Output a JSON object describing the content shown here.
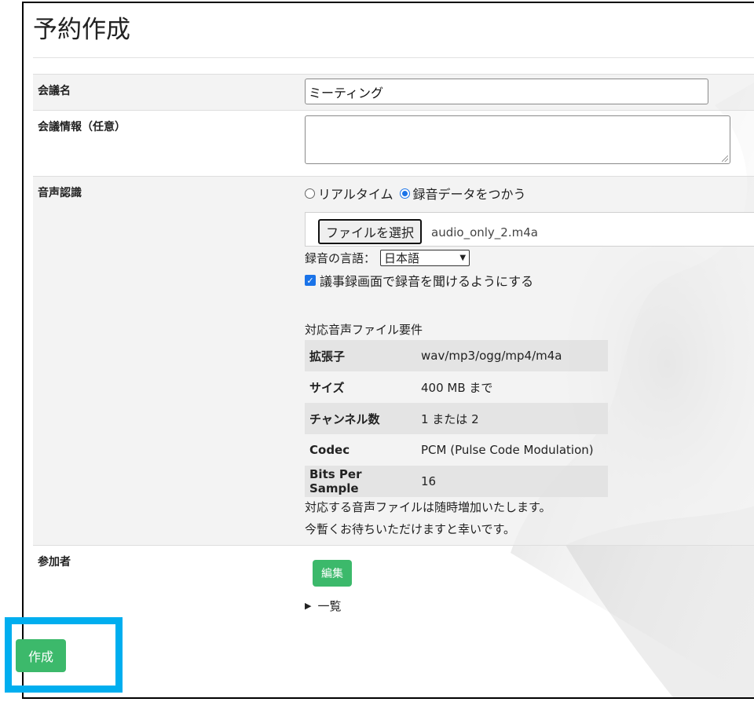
{
  "page": {
    "title": "予約作成"
  },
  "meeting_name": {
    "label": "会議名",
    "value": "ミーティング"
  },
  "meeting_info": {
    "label": "会議情報（任意）",
    "value": ""
  },
  "speech": {
    "label": "音声認識",
    "options": [
      "リアルタイム",
      "録音データをつかう"
    ],
    "selected": "録音データをつかう",
    "file_button": "ファイルを選択",
    "file_name": "audio_only_2.m4a",
    "language_label": "録音の言語：",
    "language_value": "日本語",
    "playback_checkbox": "議事録画面で録音を聞けるようにする",
    "playback_checked": true,
    "requirements_title": "対応音声ファイル要件",
    "requirements": [
      {
        "key": "拡張子",
        "value": "wav/mp3/ogg/mp4/m4a"
      },
      {
        "key": "サイズ",
        "value": "400 MB まで"
      },
      {
        "key": "チャンネル数",
        "value": "1 または 2"
      },
      {
        "key": "Codec",
        "value": "PCM (Pulse Code Modulation)"
      },
      {
        "key": "Bits Per Sample",
        "value": "16"
      }
    ],
    "note_1": "対応する音声ファイルは随時増加いたします。",
    "note_2": "今暫くお待ちいただけますと幸いです。"
  },
  "participants": {
    "label": "参加者",
    "edit_button": "編集",
    "list_toggle": "一覧"
  },
  "create_button": "作成",
  "colors": {
    "green_button": "#3cb96b",
    "highlight_box": "#00aeef",
    "radio_blue": "#1a73e8"
  }
}
